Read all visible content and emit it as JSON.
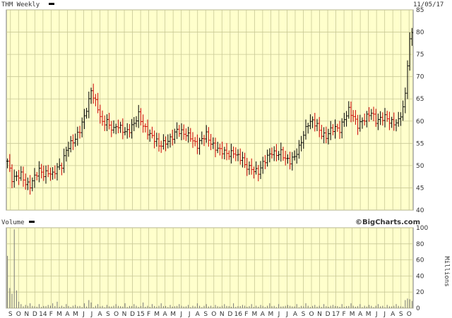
{
  "header": {
    "symbol_label": "THM Weekly",
    "date": "11/05/17"
  },
  "volume_panel": {
    "label": "Volume",
    "brand": "©BigCharts.com",
    "unit": "Millions"
  },
  "colors": {
    "background": "#ffffff",
    "panel_fill": "#ffffcc",
    "grid": "#c8c896",
    "frame": "#777777",
    "up_bar": "#000000",
    "down_bar": "#cc0000",
    "volume_bar": "#777777"
  },
  "chart_data": [
    {
      "type": "ohlc",
      "title": "THM Weekly",
      "frequency": "weekly",
      "yaxis_side": "right",
      "ylim": [
        40,
        85
      ],
      "yticks": [
        40,
        45,
        50,
        55,
        60,
        65,
        70,
        75,
        80,
        85
      ],
      "grid": true,
      "month_labels": [
        "S",
        "O",
        "N",
        "D",
        "14",
        "F",
        "M",
        "A",
        "M",
        "J",
        "J",
        "A",
        "S",
        "O",
        "N",
        "D",
        "15",
        "F",
        "M",
        "A",
        "M",
        "J",
        "J",
        "A",
        "S",
        "O",
        "N",
        "D",
        "16",
        "F",
        "M",
        "A",
        "M",
        "J",
        "J",
        "A",
        "S",
        "O",
        "N",
        "D",
        "17",
        "F",
        "M",
        "A",
        "M",
        "J",
        "J",
        "A",
        "S",
        "O"
      ],
      "close_path": [
        [
          0,
          51
        ],
        [
          2,
          47
        ],
        [
          4,
          47.5
        ],
        [
          6,
          48
        ],
        [
          8,
          46
        ],
        [
          10,
          45.5
        ],
        [
          12,
          47.5
        ],
        [
          14,
          49
        ],
        [
          16,
          48
        ],
        [
          18,
          48.5
        ],
        [
          20,
          48
        ],
        [
          22,
          49.5
        ],
        [
          24,
          50
        ],
        [
          26,
          53.5
        ],
        [
          28,
          55
        ],
        [
          30,
          56
        ],
        [
          32,
          58
        ],
        [
          34,
          61
        ],
        [
          36,
          64.5
        ],
        [
          37,
          67
        ],
        [
          38,
          65.5
        ],
        [
          40,
          63
        ],
        [
          41,
          61
        ],
        [
          42,
          59.5
        ],
        [
          44,
          60
        ],
        [
          45,
          59
        ],
        [
          47,
          58
        ],
        [
          48,
          59
        ],
        [
          50,
          58.5
        ],
        [
          52,
          57.5
        ],
        [
          54,
          58
        ],
        [
          56,
          59.5
        ],
        [
          58,
          61.5
        ],
        [
          60,
          59
        ],
        [
          62,
          57.5
        ],
        [
          64,
          56.5
        ],
        [
          66,
          55.5
        ],
        [
          67,
          54.5
        ],
        [
          69,
          55
        ],
        [
          71,
          55.5
        ],
        [
          73,
          56.5
        ],
        [
          75,
          58
        ],
        [
          77,
          57.5
        ],
        [
          79,
          57
        ],
        [
          81,
          56.5
        ],
        [
          82,
          55.5
        ],
        [
          84,
          54.5
        ],
        [
          86,
          56
        ],
        [
          88,
          57
        ],
        [
          90,
          55
        ],
        [
          92,
          54
        ],
        [
          94,
          53.5
        ],
        [
          96,
          53
        ],
        [
          98,
          52.5
        ],
        [
          100,
          53
        ],
        [
          102,
          52
        ],
        [
          104,
          51.5
        ],
        [
          105,
          50
        ],
        [
          107,
          49.5
        ],
        [
          109,
          49
        ],
        [
          111,
          48.5
        ],
        [
          113,
          50.5
        ],
        [
          115,
          52
        ],
        [
          117,
          53
        ],
        [
          119,
          52.5
        ],
        [
          121,
          53
        ],
        [
          123,
          51.5
        ],
        [
          125,
          51
        ],
        [
          127,
          52
        ],
        [
          129,
          54
        ],
        [
          131,
          57
        ],
        [
          133,
          59.5
        ],
        [
          135,
          60
        ],
        [
          137,
          59
        ],
        [
          139,
          57
        ],
        [
          141,
          56.5
        ],
        [
          143,
          58
        ],
        [
          145,
          58.5
        ],
        [
          147,
          58
        ],
        [
          149,
          60.5
        ],
        [
          151,
          62.5
        ],
        [
          153,
          61
        ],
        [
          155,
          59
        ],
        [
          157,
          60
        ],
        [
          159,
          61
        ],
        [
          161,
          62
        ],
        [
          163,
          60
        ],
        [
          165,
          60.5
        ],
        [
          167,
          61
        ],
        [
          169,
          60
        ],
        [
          171,
          59.5
        ],
        [
          173,
          60
        ],
        [
          175,
          63
        ],
        [
          176,
          66
        ],
        [
          177,
          73
        ],
        [
          178,
          78
        ],
        [
          179,
          80
        ]
      ],
      "series": [
        {
          "name": "THM",
          "values_key": "close_path"
        }
      ]
    },
    {
      "type": "bar",
      "title": "Volume",
      "ylabel": "Millions",
      "yaxis_side": "right",
      "ylim": [
        0,
        100
      ],
      "yticks": [
        0,
        20,
        40,
        60,
        80,
        100
      ],
      "grid": true,
      "spikes": [
        [
          0,
          65
        ],
        [
          1,
          25
        ],
        [
          2,
          18
        ],
        [
          3,
          98
        ],
        [
          4,
          22
        ],
        [
          5,
          8
        ],
        [
          6,
          5
        ],
        [
          8,
          4
        ],
        [
          10,
          6
        ],
        [
          14,
          5
        ],
        [
          18,
          4
        ],
        [
          20,
          6
        ],
        [
          22,
          8
        ],
        [
          26,
          5
        ],
        [
          30,
          4
        ],
        [
          34,
          6
        ],
        [
          36,
          10
        ],
        [
          37,
          7
        ],
        [
          40,
          5
        ],
        [
          44,
          4
        ],
        [
          48,
          5
        ],
        [
          52,
          6
        ],
        [
          56,
          5
        ],
        [
          60,
          7
        ],
        [
          64,
          5
        ],
        [
          68,
          6
        ],
        [
          72,
          4
        ],
        [
          76,
          5
        ],
        [
          80,
          4
        ],
        [
          84,
          6
        ],
        [
          88,
          5
        ],
        [
          92,
          4
        ],
        [
          96,
          5
        ],
        [
          100,
          6
        ],
        [
          104,
          4
        ],
        [
          108,
          5
        ],
        [
          112,
          4
        ],
        [
          116,
          6
        ],
        [
          120,
          5
        ],
        [
          124,
          4
        ],
        [
          128,
          5
        ],
        [
          132,
          6
        ],
        [
          136,
          4
        ],
        [
          140,
          5
        ],
        [
          144,
          4
        ],
        [
          148,
          5
        ],
        [
          152,
          6
        ],
        [
          156,
          5
        ],
        [
          160,
          4
        ],
        [
          164,
          5
        ],
        [
          168,
          4
        ],
        [
          172,
          5
        ],
        [
          176,
          10
        ],
        [
          177,
          12
        ],
        [
          178,
          11
        ],
        [
          179,
          9
        ]
      ]
    }
  ]
}
